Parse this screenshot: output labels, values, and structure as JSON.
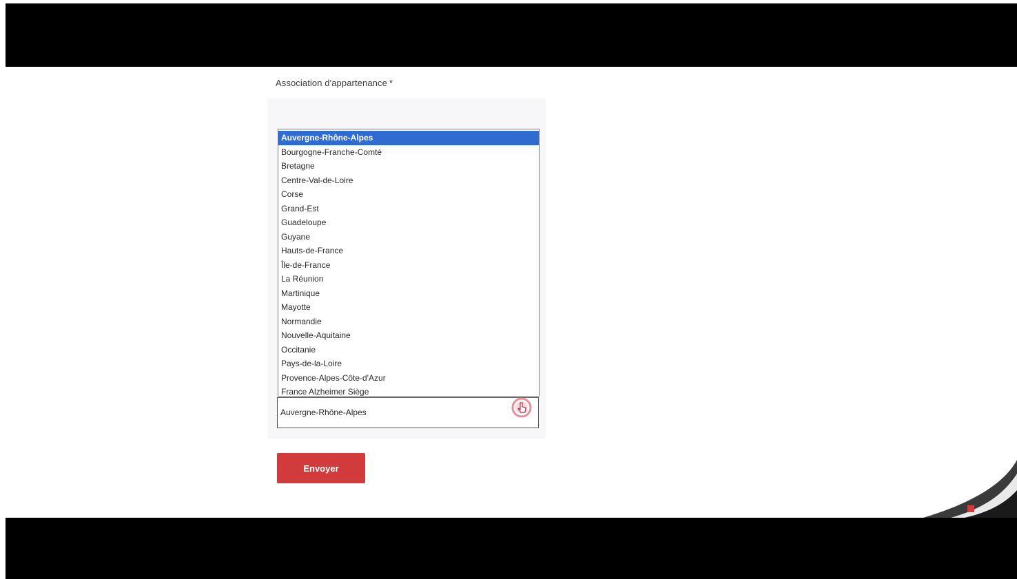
{
  "form": {
    "field_label": "Association d'appartenance",
    "required_mark": "*",
    "options": [
      "Auvergne-Rhône-Alpes",
      "Bourgogne-Franche-Comté",
      "Bretagne",
      "Centre-Val-de-Loire",
      "Corse",
      "Grand-Est",
      "Guadeloupe",
      "Guyane",
      "Hauts-de-France",
      "Île-de-France",
      "La Réunion",
      "Martinique",
      "Mayotte",
      "Normandie",
      "Nouvelle-Aquitaine",
      "Occitanie",
      "Pays-de-la-Loire",
      "Provence-Alpes-Côte-d'Azur",
      "France Alzheimer Siège"
    ],
    "selected_index": 0,
    "selected_value": "Auvergne-Rhône-Alpes",
    "submit_label": "Envoyer"
  },
  "colors": {
    "selection": "#2f6bd1",
    "submit_button": "#d23b3b",
    "letterbox": "#000000",
    "cursor_highlight": "#e06a7a"
  },
  "icons": {
    "cursor": "pointer-hand-icon",
    "logo": "page-curl-logo-icon"
  }
}
